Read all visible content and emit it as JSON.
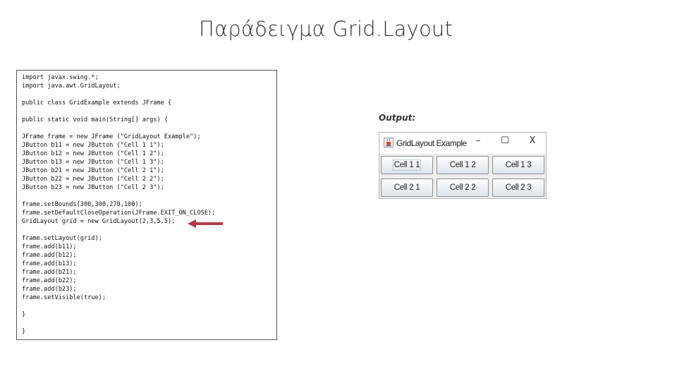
{
  "slide": {
    "title": "Παράδειγμα Grid.Layout"
  },
  "code": {
    "lines": [
      "import javax.swing.*;",
      "import java.awt.GridLayout;",
      "",
      "public class GridExample extends JFrame {",
      "",
      "public static void main(String[] args) {",
      "",
      "JFrame frame = new JFrame (\"GridLayout Example\");",
      "JButton b11 = new JButton (\"Cell 1 1\");",
      "JButton b12 = new JButton (\"Cell 1 2\");",
      "JButton b13 = new JButton (\"Cell 1 3\");",
      "JButton b21 = new JButton (\"Cell 2 1\");",
      "JButton b22 = new JButton (\"Cell 2 2\");",
      "JButton b23 = new JButton (\"Cell 2 3\");",
      "",
      "frame.setBounds(300,300,270,100);",
      "frame.setDefaultCloseOperation(JFrame.EXIT_ON_CLOSE);",
      "GridLayout grid = new GridLayout(2,3,5,5);",
      "",
      "frame.setLayout(grid);",
      "frame.add(b11);",
      "frame.add(b12);",
      "frame.add(b13);",
      "frame.add(b21);",
      "frame.add(b22);",
      "frame.add(b23);",
      "frame.setVisible(true);",
      "",
      "}",
      "",
      "}"
    ],
    "arrow_color": "#b03a48"
  },
  "output": {
    "label": "Output:",
    "window": {
      "title": "GridLayout Example",
      "minimize": "–",
      "maximize": "☐",
      "close": "X",
      "icon": "java-cup-icon"
    },
    "buttons": [
      [
        "Cell 1 1",
        "Cell 1 2",
        "Cell 1 3"
      ],
      [
        "Cell 2 1",
        "Cell 2 2",
        "Cell 2 3"
      ]
    ]
  }
}
